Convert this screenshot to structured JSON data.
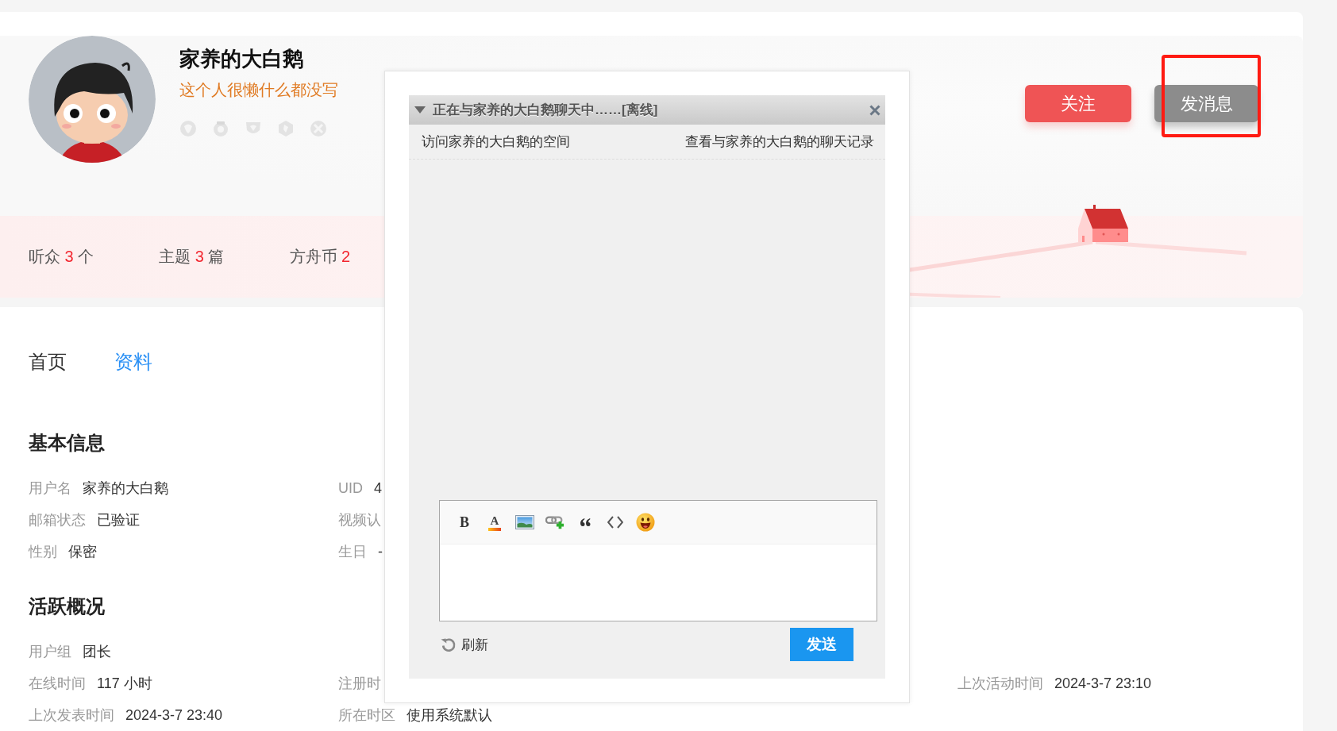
{
  "profile": {
    "username": "家养的大白鹅",
    "bio": "这个人很懒什么都没写",
    "actions": [
      {
        "kind": "follow",
        "label": "关注",
        "highlighted": false
      },
      {
        "kind": "message",
        "label": "发消息",
        "highlighted": true
      }
    ],
    "stats": [
      {
        "label": "听众",
        "value": "3",
        "unit": "个"
      },
      {
        "label": "主题",
        "value": "3",
        "unit": "篇"
      },
      {
        "label": "方舟币",
        "value": "2"
      }
    ]
  },
  "tabs": [
    {
      "label": "首页",
      "selected": false
    },
    {
      "label": "资料",
      "selected": true
    }
  ],
  "sections": [
    {
      "title": "基本信息",
      "rows": [
        [
          {
            "label": "用户名",
            "value": "家养的大白鹅"
          },
          {
            "label": "UID",
            "value": "4"
          }
        ],
        [
          {
            "label": "邮箱状态",
            "value": "已验证"
          },
          {
            "label": "视频认"
          }
        ],
        [
          {
            "label": "性别",
            "value": "保密"
          },
          {
            "label": "生日",
            "value": "-"
          }
        ]
      ]
    },
    {
      "title": "活跃概况",
      "rows": [
        [
          {
            "label": "用户组",
            "value": "团长"
          }
        ],
        [
          {
            "label": "在线时间",
            "value": "117 小时"
          },
          {
            "label": "注册时"
          },
          {
            "label": "上次活动时间",
            "value": "2024-3-7 23:10"
          }
        ],
        [
          {
            "label": "上次发表时间",
            "value": "2024-3-7 23:40"
          },
          {
            "label": "所在时区",
            "value": "使用系统默认"
          }
        ]
      ]
    }
  ],
  "chat_dialog": {
    "title": "正在与家养的大白鹅聊天中……[离线]",
    "links": [
      "访问家养的大白鹅的空间",
      "查看与家养的大白鹅的聊天记录"
    ],
    "toolbar": [
      {
        "kind": "bold",
        "text": "B"
      },
      {
        "kind": "font_color",
        "text": "A"
      },
      {
        "kind": "image"
      },
      {
        "kind": "link"
      },
      {
        "kind": "quote"
      },
      {
        "kind": "code"
      },
      {
        "kind": "emoji"
      }
    ],
    "refresh": "刷新",
    "send": "发送"
  }
}
